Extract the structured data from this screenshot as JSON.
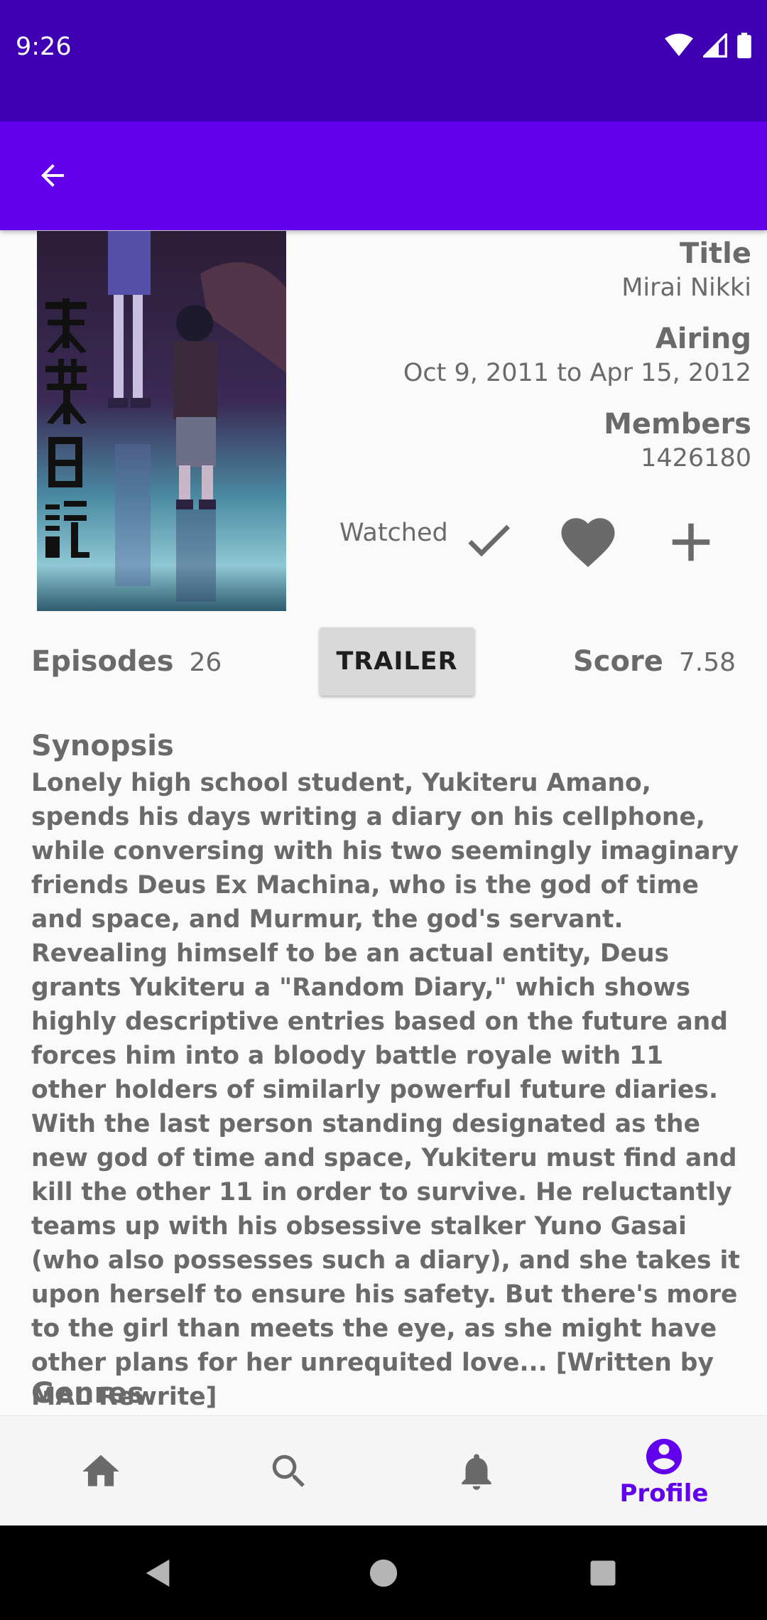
{
  "status_bar": {
    "time": "9:26"
  },
  "details": {
    "title_label": "Title",
    "title_value": "Mirai Nikki",
    "airing_label": "Airing",
    "airing_value": "Oct 9, 2011 to Apr 15, 2012",
    "members_label": "Members",
    "members_value": "1426180",
    "watched_label": "Watched"
  },
  "stats": {
    "episodes_label": "Episodes",
    "episodes_value": "26",
    "trailer_button": "TRAILER",
    "score_label": "Score",
    "score_value": "7.58"
  },
  "synopsis": {
    "heading": "Synopsis",
    "text": "Lonely high school student, Yukiteru Amano, spends his days writing a diary on his cellphone, while conversing with his two seemingly imaginary friends Deus Ex Machina, who is the god of time and space, and Murmur, the god's servant. Revealing himself to be an actual entity, Deus grants Yukiteru a \"Random Diary,\" which shows highly descriptive entries based on the future and forces him into a bloody battle royale with 11 other holders of similarly powerful future diaries. With the last person standing designated as the new god of time and space, Yukiteru must find and kill the other 11 in order to survive. He reluctantly teams up with his obsessive stalker Yuno Gasai (who also possesses such a diary), and she takes it upon herself to ensure his safety. But there's more to the girl than meets the eye, as she might have other plans for her unrequited love... [Written by MAL Rewrite]"
  },
  "genres": {
    "heading": "Genres"
  },
  "bottom_nav": {
    "items": [
      {
        "icon": "home-icon",
        "label": ""
      },
      {
        "icon": "search-icon",
        "label": ""
      },
      {
        "icon": "bell-icon",
        "label": ""
      },
      {
        "icon": "profile-icon",
        "label": "Profile"
      }
    ]
  },
  "colors": {
    "status_bar": "#3f00b4",
    "app_bar": "#6200ee",
    "accent": "#6200ee",
    "text_gray": "#6a6a6a"
  }
}
